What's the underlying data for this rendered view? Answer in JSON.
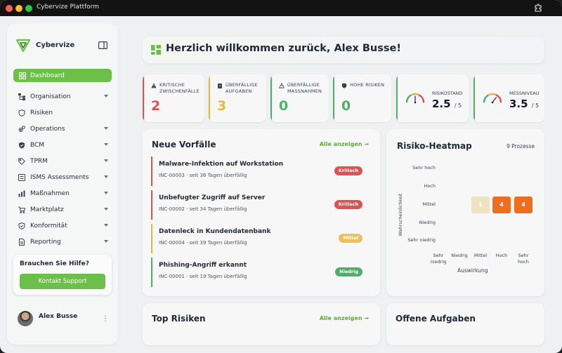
{
  "window": {
    "title": "Cybervize Plattform"
  },
  "sidebar": {
    "brand": "Cybervize",
    "active_item": {
      "label": "Dashboard",
      "icon": "grid-icon"
    },
    "items": [
      {
        "label": "Organisation",
        "icon": "org-chart-icon",
        "has_submenu": true
      },
      {
        "label": "Risiken",
        "icon": "shield-icon",
        "has_submenu": false
      },
      {
        "label": "Operations",
        "icon": "gears-icon",
        "has_submenu": true
      },
      {
        "label": "BCM",
        "icon": "shield-check-icon",
        "has_submenu": true
      },
      {
        "label": "TPRM",
        "icon": "tag-icon",
        "has_submenu": true
      },
      {
        "label": "ISMS Assessments",
        "icon": "list-icon",
        "has_submenu": true
      },
      {
        "label": "Maßnahmen",
        "icon": "chart-icon",
        "has_submenu": true
      },
      {
        "label": "Marktplatz",
        "icon": "cart-icon",
        "has_submenu": true
      },
      {
        "label": "Konformität",
        "icon": "shield-check-icon",
        "has_submenu": true
      },
      {
        "label": "Reporting",
        "icon": "document-icon",
        "has_submenu": true
      }
    ],
    "help": {
      "title": "Brauchen Sie Hilfe?",
      "button": "Kontakt Support"
    },
    "user": {
      "name": "Alex Busse"
    }
  },
  "welcome": {
    "text": "Herzlich willkommen zurück, Alex Busse!"
  },
  "kpis": [
    {
      "label": "Kritische Zwischenfälle",
      "value": "2",
      "color": "#e05252",
      "icon": "warning-icon"
    },
    {
      "label": "Überfällige Aufgaben",
      "value": "3",
      "color": "#e2b93b",
      "icon": "clipboard-icon"
    },
    {
      "label": "Überfällige Maßnahmen",
      "value": "0",
      "color": "#4db06a",
      "icon": "warning-icon"
    },
    {
      "label": "Hohe Risiken",
      "value": "0",
      "color": "#4db06a",
      "icon": "shield-icon"
    }
  ],
  "gauges": [
    {
      "label": "Risikostand",
      "value": "2.5",
      "max": "/ 5",
      "level": 0.5
    },
    {
      "label": "Messniveau",
      "value": "3.5",
      "max": "/ 5",
      "level": 0.7
    }
  ],
  "incidents": {
    "title": "Neue Vorfälle",
    "link": "Alle anzeigen →",
    "items": [
      {
        "title": "Malware-Infektion auf Workstation",
        "sub": "INC-00003 · seit 36 Tagen überfällig",
        "badge": "Kritisch",
        "color": "#e05252",
        "badge_bg": "#e05252",
        "badge_fg": "#ffffff"
      },
      {
        "title": "Unbefugter Zugriff auf Server",
        "sub": "INC-00002 · seit 34 Tagen überfällig",
        "badge": "Kritisch",
        "color": "#e05252",
        "badge_bg": "#e05252",
        "badge_fg": "#ffffff"
      },
      {
        "title": "Datenleck in Kundendatenbank",
        "sub": "INC-00004 · seit 39 Tagen überfällig",
        "badge": "Mittel",
        "color": "#e2b93b",
        "badge_bg": "#e9c25a",
        "badge_fg": "#ffffff"
      },
      {
        "title": "Phishing-Angriff erkannt",
        "sub": "INC-00001 · seit 19 Tagen überfällig",
        "badge": "Niedrig",
        "color": "#4db06a",
        "badge_bg": "#4db06a",
        "badge_fg": "#ffffff"
      }
    ]
  },
  "heatmap": {
    "title": "Risiko-Heatmap",
    "count": "9 Prozesse",
    "ylabel": "Wahrscheinlichkeit",
    "xlabel": "Auswirkung",
    "rows": [
      "Sehr hoch",
      "Hoch",
      "Mittel",
      "Niedrig",
      "Sehr niedrig"
    ],
    "cols": [
      "Sehr niedrig",
      "Niedrig",
      "Mittel",
      "Hoch",
      "Sehr hoch"
    ],
    "cells": [
      {
        "row": 2,
        "col": 2,
        "value": "1",
        "bg": "#efe2bf",
        "fg": "#ffffff"
      },
      {
        "row": 2,
        "col": 3,
        "value": "4",
        "bg": "#ee6d1f",
        "fg": "#ffffff"
      },
      {
        "row": 2,
        "col": 4,
        "value": "4",
        "bg": "#ee6d1f",
        "fg": "#ffffff"
      }
    ]
  },
  "risks": {
    "title": "Top Risiken",
    "link": "Alle anzeigen →"
  },
  "tasks": {
    "title": "Offene Aufgaben"
  }
}
